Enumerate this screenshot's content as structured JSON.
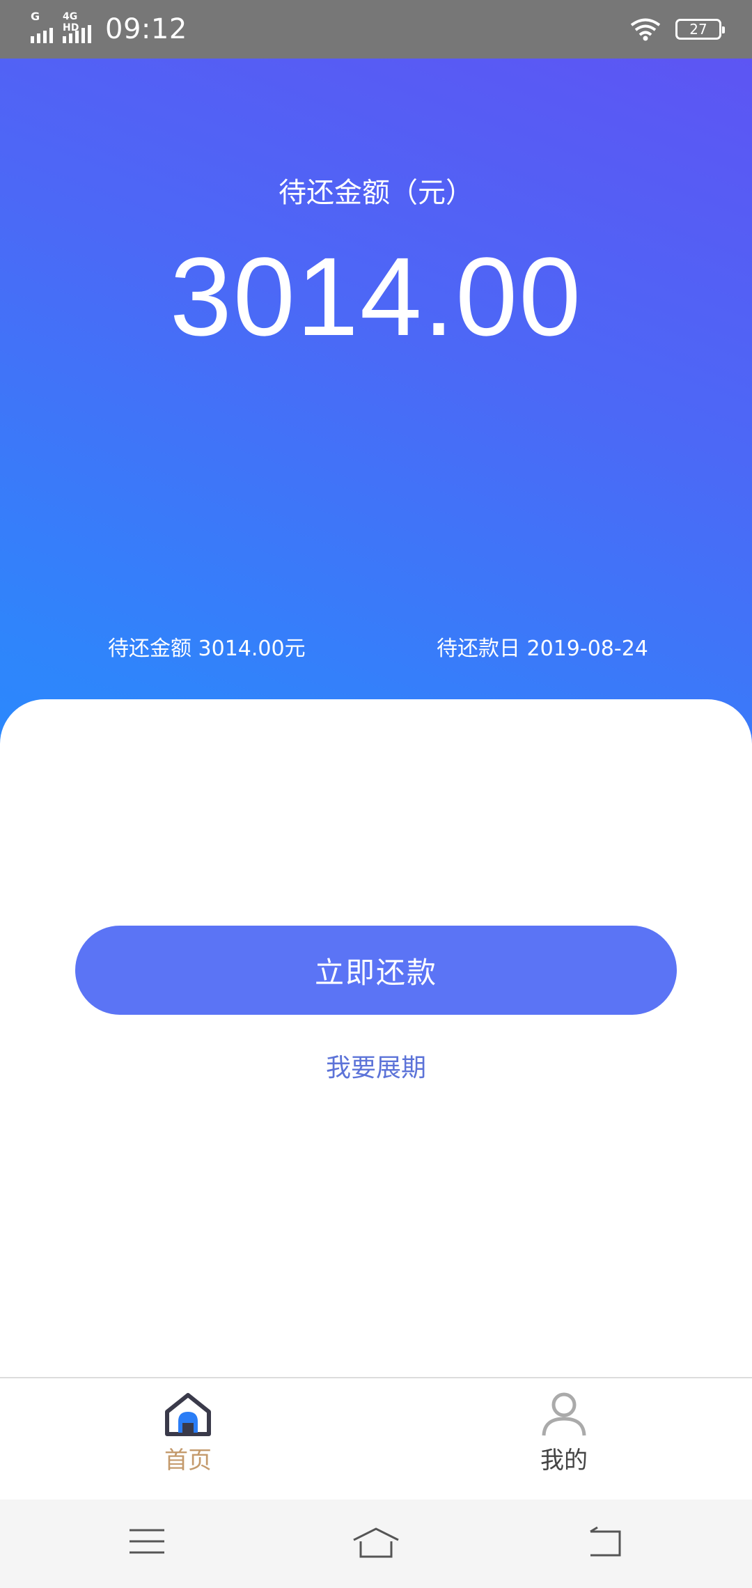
{
  "status_bar": {
    "sim1_label": "G",
    "sim2_label": "4G HD",
    "time": "09:12",
    "battery": "27"
  },
  "hero": {
    "label": "待还金额（元）",
    "amount": "3014.00",
    "pending_amount_text": "待还金额 3014.00元",
    "due_date_text": "待还款日 2019-08-24"
  },
  "actions": {
    "repay_button": "立即还款",
    "extend_link": "我要展期"
  },
  "tab_bar": {
    "tabs": [
      {
        "label": "首页",
        "icon": "home-icon",
        "active": true
      },
      {
        "label": "我的",
        "icon": "user-icon",
        "active": false
      }
    ]
  },
  "nav_bar": {
    "icons": [
      "menu-icon",
      "home-outline-icon",
      "back-icon"
    ]
  },
  "colors": {
    "accent": "#5b74f5",
    "link": "#5c73d8",
    "active_tab": "#c49a6c",
    "gradient_top": "#5d55f3",
    "gradient_bottom": "#2a89fd"
  }
}
